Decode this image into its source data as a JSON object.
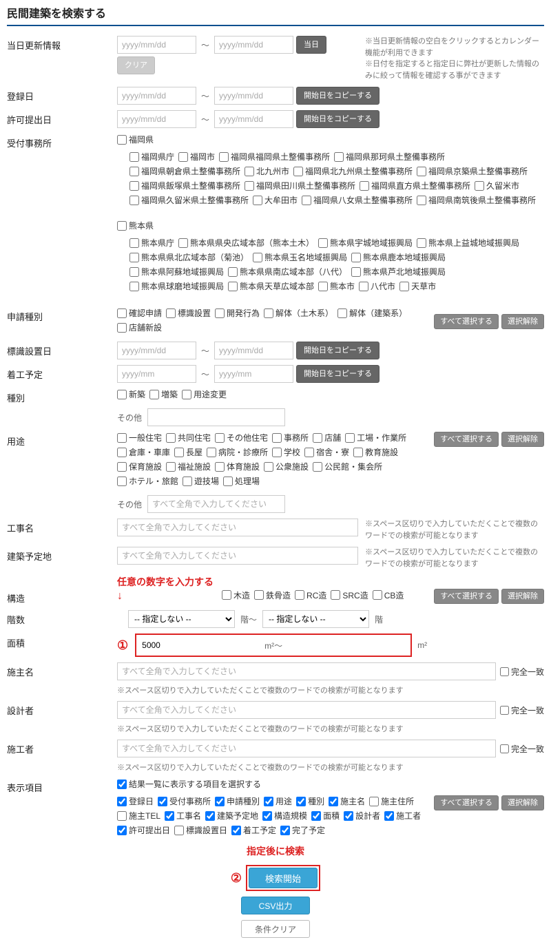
{
  "title": "民間建築を検索する",
  "labels": {
    "updateInfo": "当日更新情報",
    "regDate": "登録日",
    "permitDate": "許可提出日",
    "office": "受付事務所",
    "appType": "申請種別",
    "signDate": "標識設置日",
    "startDate": "着工予定",
    "kind": "種別",
    "usage": "用途",
    "workName": "工事名",
    "buildSite": "建築予定地",
    "structure": "構造",
    "floors": "階数",
    "area": "面積",
    "owner": "施主名",
    "designer": "設計者",
    "builder": "施工者",
    "display": "表示項目",
    "other": "その他",
    "exact": "完全一致",
    "floorUnit": "階",
    "floorTilde": "階～",
    "areaUnit": "m²",
    "areaTilde": "m²～"
  },
  "placeholders": {
    "date": "yyyy/mm/dd",
    "month": "yyyy/mm",
    "fullwidth": "すべて全角で入力してください"
  },
  "buttons": {
    "today": "当日",
    "clear": "クリア",
    "copyStart": "開始日をコピーする",
    "selectAll": "すべて選択する",
    "deselect": "選択解除",
    "search": "検索開始",
    "csv": "CSV出力",
    "condClear": "条件クリア"
  },
  "notes": {
    "update1": "※当日更新情報の空白をクリックするとカレンダー機能が利用できます",
    "update2": "※日付を指定すると指定日に弊社が更新した情報のみに絞って情報を確認する事ができます",
    "space": "※スペース区切りで入力していただくことで複数のワードでの検索が可能となります"
  },
  "offices": {
    "fukuoka": "福岡県",
    "fukuokaList": [
      "福岡県庁",
      "福岡市",
      "福岡県福岡県土整備事務所",
      "福岡県那珂県土整備事務所",
      "福岡県朝倉県土整備事務所",
      "北九州市",
      "福岡県北九州県土整備事務所",
      "福岡県京築県土整備事務所",
      "福岡県飯塚県土整備事務所",
      "福岡県田川県土整備事務所",
      "福岡県直方県土整備事務所",
      "久留米市",
      "福岡県久留米県土整備事務所",
      "大牟田市",
      "福岡県八女県土整備事務所",
      "福岡県南筑後県土整備事務所"
    ],
    "kumamoto": "熊本県",
    "kumamotoList": [
      "熊本県庁",
      "熊本県県央広域本部（熊本土木）",
      "熊本県宇城地域振興局",
      "熊本県上益城地域振興局",
      "熊本県県北広域本部（菊池）",
      "熊本県玉名地域振興局",
      "熊本県鹿本地域振興局",
      "熊本県阿蘇地域振興局",
      "熊本県県南広域本部（八代）",
      "熊本県芦北地域振興局",
      "熊本県球磨地域振興局",
      "熊本県天草広域本部",
      "熊本市",
      "八代市",
      "天草市"
    ]
  },
  "appTypes": [
    "確認申請",
    "標識設置",
    "開発行為",
    "解体（土木系）",
    "解体（建築系）",
    "店舗新設"
  ],
  "kinds": [
    "新築",
    "増築",
    "用途変更"
  ],
  "usages": [
    "一般住宅",
    "共同住宅",
    "その他住宅",
    "事務所",
    "店舗",
    "工場・作業所",
    "倉庫・車庫",
    "長屋",
    "病院・診療所",
    "学校",
    "宿舎・寮",
    "教育施設",
    "保育施設",
    "福祉施設",
    "体育施設",
    "公衆施設",
    "公民館・集会所",
    "ホテル・旅館",
    "遊技場",
    "処理場"
  ],
  "structures": [
    "木造",
    "鉄骨造",
    "RC造",
    "SRC造",
    "CB造"
  ],
  "floorOpt": "-- 指定しない --",
  "areaValue": "5000",
  "dispHeader": "結果一覧に表示する項目を選択する",
  "dispItems": [
    {
      "t": "登録日",
      "c": true
    },
    {
      "t": "受付事務所",
      "c": true
    },
    {
      "t": "申請種別",
      "c": true
    },
    {
      "t": "用途",
      "c": true
    },
    {
      "t": "種別",
      "c": true
    },
    {
      "t": "施主名",
      "c": true
    },
    {
      "t": "施主住所",
      "c": false
    },
    {
      "t": "施主TEL",
      "c": false
    },
    {
      "t": "工事名",
      "c": true
    },
    {
      "t": "建築予定地",
      "c": true
    },
    {
      "t": "構造規模",
      "c": true
    },
    {
      "t": "面積",
      "c": true
    },
    {
      "t": "設計者",
      "c": true
    },
    {
      "t": "施工者",
      "c": true
    },
    {
      "t": "許可提出日",
      "c": true
    },
    {
      "t": "標識設置日",
      "c": false
    },
    {
      "t": "着工予定",
      "c": true
    },
    {
      "t": "完了予定",
      "c": true
    }
  ],
  "annotations": {
    "anyNumber": "任意の数字を入力する",
    "afterSpec": "指定後に検索",
    "one": "①",
    "two": "②"
  }
}
